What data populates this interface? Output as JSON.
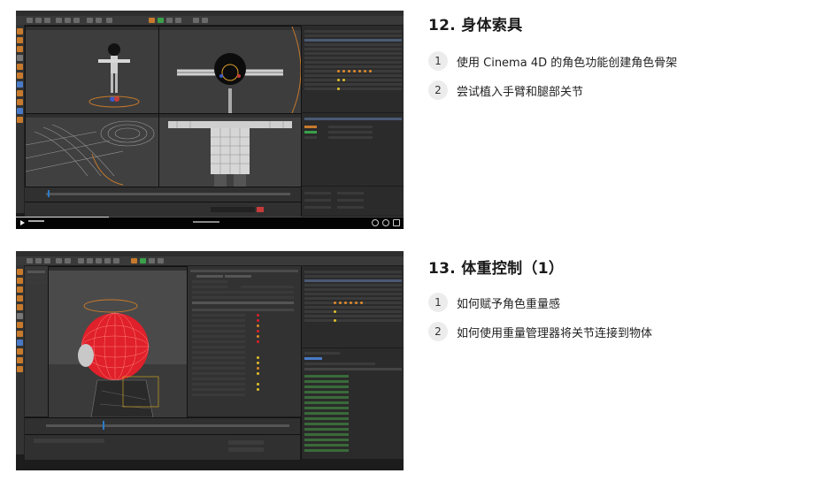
{
  "lessons": [
    {
      "title": "12. 身体索具",
      "items": [
        {
          "num": "1",
          "text": "使用 Cinema 4D 的角色功能创建角色骨架"
        },
        {
          "num": "2",
          "text": "尝试植入手臂和腿部关节"
        }
      ]
    },
    {
      "title": "13. 体重控制（1）",
      "items": [
        {
          "num": "1",
          "text": "如何赋予角色重量感"
        },
        {
          "num": "2",
          "text": "如何使用重量管理器将关节连接到物体"
        }
      ]
    }
  ],
  "video": {
    "progress": 0.24,
    "icons": [
      "play-icon",
      "volume-icon",
      "settings-icon",
      "fullscreen-icon"
    ]
  },
  "colors": {
    "app_bg": "#1c1c1c",
    "viewport": "#3d3d3d",
    "accent_orange": "#c77a2c",
    "selection_red": "#e0202a",
    "badge_bg": "#ececec"
  }
}
